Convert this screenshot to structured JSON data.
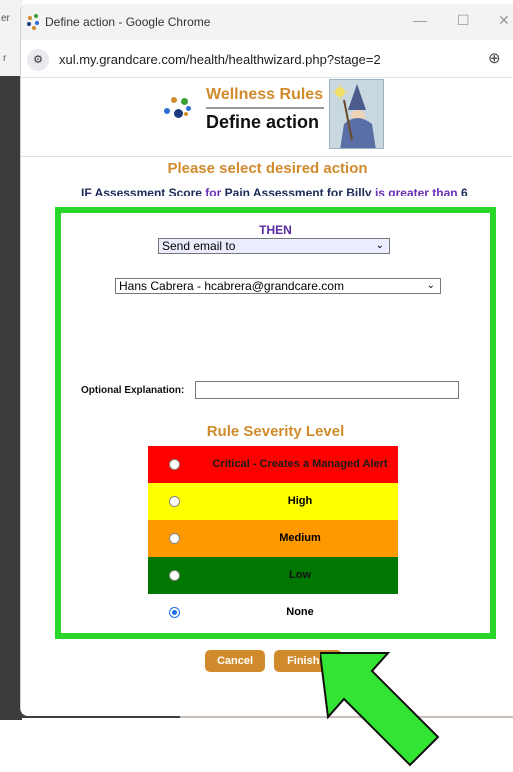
{
  "window": {
    "title": "Define action - Google Chrome",
    "minimize": "—",
    "maximize": "☐",
    "close": "✕"
  },
  "address_bar": {
    "url": "xul.my.grandcare.com/health/healthwizard.php?stage=2",
    "site_icon": "⚙",
    "zoom_icon": "⊕"
  },
  "background_window": {
    "fragment_top": "er",
    "fragment_mid": "r"
  },
  "header": {
    "title": "Wellness Rules",
    "subtitle": "Define action"
  },
  "main": {
    "heading": "Please select desired action",
    "condition": {
      "prefix": "IF",
      "part1": "Assessment Score",
      "for1": "for",
      "part2": "Pain Assessment for Billy",
      "comparator": "is greater than",
      "value": "6"
    },
    "then_label": "THEN",
    "action_select": "Send email to",
    "recipient_select": "Hans Cabrera - hcabrera@grandcare.com",
    "explanation_label": "Optional Explanation:",
    "explanation_value": ""
  },
  "severity": {
    "heading": "Rule Severity Level",
    "levels": [
      {
        "label": "Critical - Creates a Managed Alert",
        "color": "#ff0000",
        "text_color": "#1a1a1a",
        "checked": false
      },
      {
        "label": "High",
        "color": "#ffff00",
        "text_color": "#000000",
        "checked": false
      },
      {
        "label": "Medium",
        "color": "#ff9900",
        "text_color": "#000000",
        "checked": false
      },
      {
        "label": "Low",
        "color": "#007700",
        "text_color": "#111111",
        "checked": false
      },
      {
        "label": "None",
        "color": "#ffffff",
        "text_color": "#000000",
        "checked": true
      }
    ]
  },
  "buttons": {
    "cancel": "Cancel",
    "finish": "Finish >"
  },
  "colors": {
    "accent_orange": "#d28b2c",
    "highlight_green": "#2bd62b",
    "purple": "#6a2fb5"
  }
}
